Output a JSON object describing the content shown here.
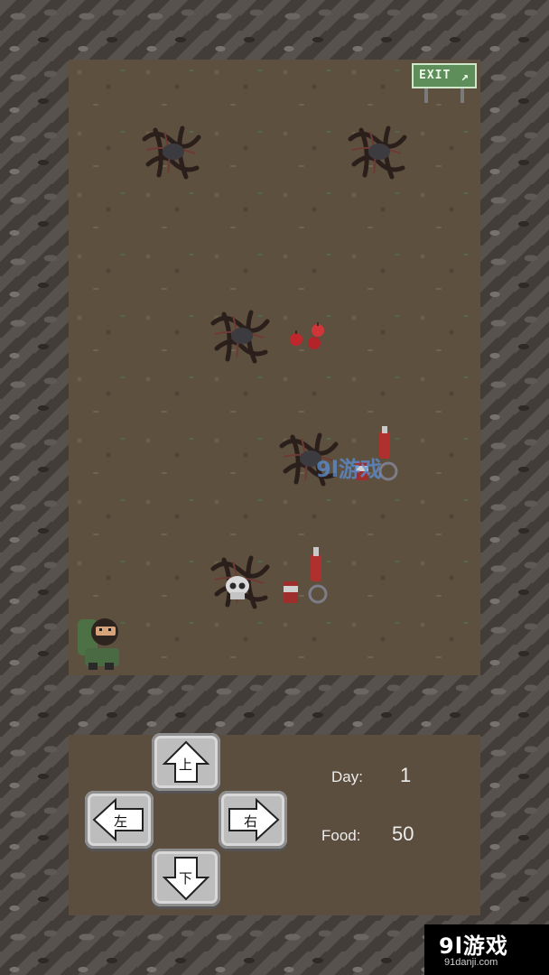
{
  "game": {
    "exit_sign_text": "EXIT",
    "entities": {
      "player": "player-sprite",
      "exit": "exit-sign-icon",
      "brambles": [
        "bramble-icon",
        "bramble-icon",
        "bramble-icon",
        "bramble-icon",
        "bramble-icon"
      ],
      "food_items": [
        "apples-icon",
        "soda-icon",
        "soda-icon"
      ],
      "enemies": [
        "skull-icon"
      ]
    }
  },
  "controls": {
    "up_label": "上",
    "left_label": "左",
    "right_label": "右",
    "down_label": "下"
  },
  "stats": {
    "day_label": "Day:",
    "day_value": "1",
    "food_label": "Food:",
    "food_value": "50"
  },
  "watermark": {
    "logo_text": "9l游戏",
    "url_text": "91danji.com",
    "overlay_text": "9l游戏"
  },
  "colors": {
    "floor": "#5e503e",
    "wall": "#4a4540",
    "exit_sign": "#5e8f5a",
    "text": "#ececec"
  }
}
